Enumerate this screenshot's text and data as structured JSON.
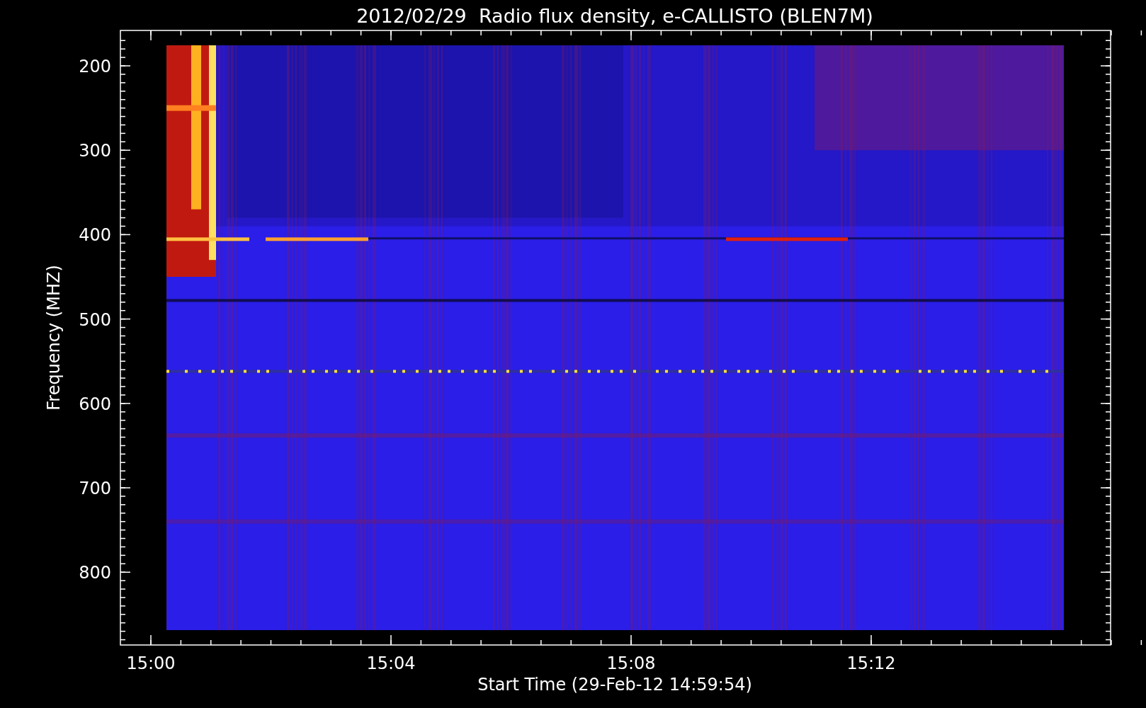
{
  "title": "2012/02/29  Radio flux density, e-CALLISTO (BLEN7M)",
  "ylabel": "Frequency (MHZ)",
  "xlabel": "Start Time (29-Feb-12 14:59:54)",
  "y_ticks": [
    "200",
    "300",
    "400",
    "500",
    "600",
    "700",
    "800"
  ],
  "x_ticks": [
    "15:00",
    "15:04",
    "15:08",
    "15:12"
  ]
}
